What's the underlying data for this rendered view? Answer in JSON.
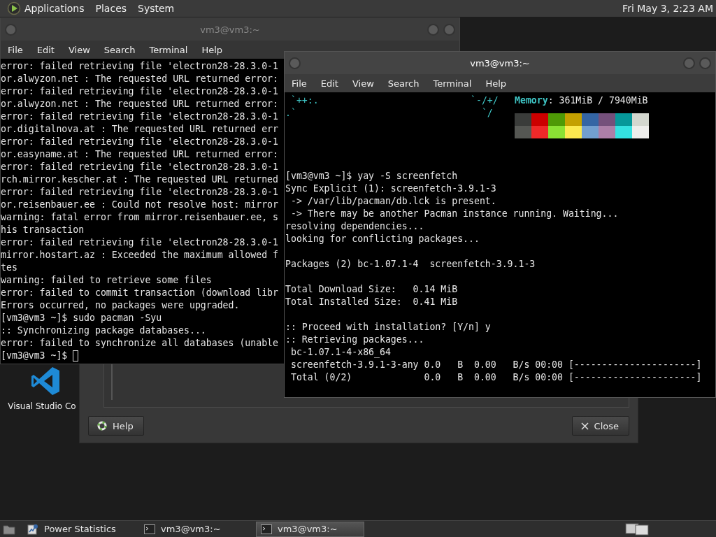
{
  "top_panel": {
    "menus": [
      "Applications",
      "Places",
      "System"
    ],
    "clock": "Fri May 3, 2:23 AM"
  },
  "desktop_icons": [
    {
      "label": "Visual Studio Co"
    }
  ],
  "dialog": {
    "buttons": [
      {
        "kind": "help",
        "label": "Help"
      },
      {
        "kind": "close",
        "label": "Close"
      }
    ]
  },
  "back_terminal": {
    "title": "vm3@vm3:~",
    "menu": [
      "File",
      "Edit",
      "View",
      "Search",
      "Terminal",
      "Help"
    ],
    "lines": [
      "error: failed retrieving file 'electron28-28.3.0-1",
      "or.alwyzon.net : The requested URL returned error:",
      "error: failed retrieving file 'electron28-28.3.0-1",
      "or.alwyzon.net : The requested URL returned error:",
      "error: failed retrieving file 'electron28-28.3.0-1",
      "or.digitalnova.at : The requested URL returned err",
      "error: failed retrieving file 'electron28-28.3.0-1",
      "or.easyname.at : The requested URL returned error:",
      "error: failed retrieving file 'electron28-28.3.0-1",
      "rch.mirror.kescher.at : The requested URL returned",
      "error: failed retrieving file 'electron28-28.3.0-1",
      "or.reisenbauer.ee : Could not resolve host: mirror",
      "warning: fatal error from mirror.reisenbauer.ee, s",
      "his transaction",
      "error: failed retrieving file 'electron28-28.3.0-1",
      "mirror.hostart.az : Exceeded the maximum allowed f",
      "tes",
      "warning: failed to retrieve some files",
      "error: failed to commit transaction (download libr",
      "Errors occurred, no packages were upgraded.",
      "[vm3@vm3 ~]$ sudo pacman -Syu",
      ":: Synchronizing package databases...",
      "error: failed to synchronize all databases (unable"
    ],
    "prompt": "[vm3@vm3 ~]$ "
  },
  "front_terminal": {
    "title": "vm3@vm3:~",
    "menu": [
      "File",
      "Edit",
      "View",
      "Search",
      "Terminal",
      "Help"
    ],
    "logo_left": [
      " `++:.",
      ".`"
    ],
    "logo_right": [
      "`-/+/",
      "  `/"
    ],
    "memory_label": "Memory",
    "memory_value": ": 361MiB / 7940MiB",
    "palette": [
      {
        "color": "#3a3c3a"
      },
      {
        "color": "#cc0000"
      },
      {
        "color": "#4e9a06"
      },
      {
        "color": "#c4a000"
      },
      {
        "color": "#3465a4"
      },
      {
        "color": "#75507b"
      },
      {
        "color": "#06989a"
      },
      {
        "color": "#d3d7cf"
      },
      {
        "color": "#555753"
      },
      {
        "color": "#ef2929"
      },
      {
        "color": "#8ae234"
      },
      {
        "color": "#fce94f"
      },
      {
        "color": "#729fcf"
      },
      {
        "color": "#ad7fa8"
      },
      {
        "color": "#34e2e2"
      },
      {
        "color": "#eeeeec"
      }
    ],
    "blocks": [
      [
        "[vm3@vm3 ~]$ yay -S screenfetch",
        "Sync Explicit (1): screenfetch-3.9.1-3",
        " -> /var/lib/pacman/db.lck is present.",
        " -> There may be another Pacman instance running. Waiting...",
        "resolving dependencies...",
        "looking for conflicting packages..."
      ],
      [
        "Packages (2) bc-1.07.1-4  screenfetch-3.9.1-3"
      ],
      [
        "Total Download Size:   0.14 MiB",
        "Total Installed Size:  0.41 MiB"
      ],
      [
        ":: Proceed with installation? [Y/n] y",
        ":: Retrieving packages...",
        " bc-1.07.1-4-x86_64",
        " screenfetch-3.9.1-3-any 0.0   B  0.00   B/s 00:00 [----------------------]",
        " Total (0/2)             0.0   B  0.00   B/s 00:00 [----------------------]"
      ]
    ]
  },
  "taskbar": {
    "items": [
      {
        "kind": "power",
        "label": "Power Statistics",
        "selected": false
      },
      {
        "kind": "terminal",
        "label": "vm3@vm3:~",
        "selected": false
      },
      {
        "kind": "terminal",
        "label": "vm3@vm3:~",
        "selected": true
      }
    ]
  }
}
